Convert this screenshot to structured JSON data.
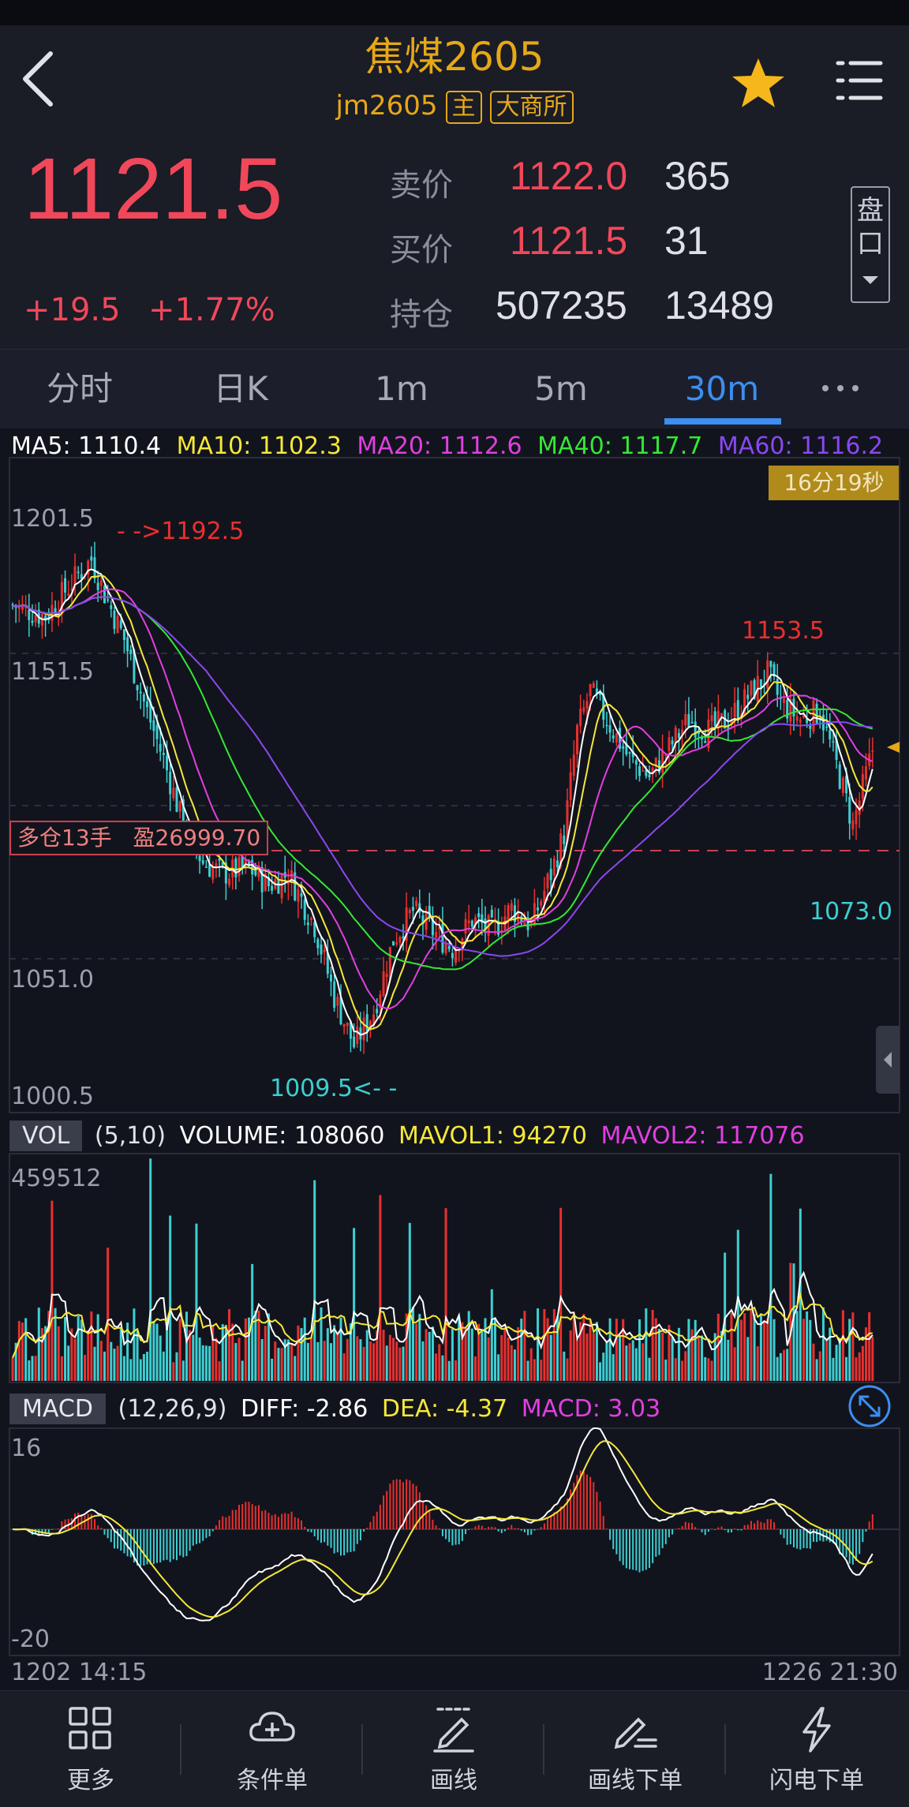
{
  "header": {
    "title": "焦煤2605",
    "code": "jm2605",
    "tag_main": "主",
    "tag_exchange": "大商所"
  },
  "quote": {
    "last_price": "1121.5",
    "change": "+19.5",
    "change_pct": "+1.77%",
    "ask_label": "卖价",
    "ask_price": "1122.0",
    "ask_vol": "365",
    "bid_label": "买价",
    "bid_price": "1121.5",
    "bid_vol": "31",
    "oi_label": "持仓",
    "open_interest": "507235",
    "oi_change": "13489",
    "panel_button": "盘口"
  },
  "tabs": [
    "分时",
    "日K",
    "1m",
    "5m",
    "30m"
  ],
  "active_tab": "30m",
  "main_chart": {
    "ma_labels": [
      {
        "text": "MA5: 1110.4",
        "color": "#ffffff"
      },
      {
        "text": "MA10: 1102.3",
        "color": "#f5e83a"
      },
      {
        "text": "MA20: 1112.6",
        "color": "#e040e0"
      },
      {
        "text": "MA40: 1117.7",
        "color": "#34e834"
      },
      {
        "text": "MA60: 1116.2",
        "color": "#8a48f0"
      }
    ],
    "countdown": "16分19秒",
    "y_ticks": [
      "1201.5",
      "1151.5",
      "1051.0",
      "1000.5"
    ],
    "high_note": "- ->1192.5",
    "low_note": "1009.5<- -",
    "recent_high": "1153.5",
    "recent_low": "1073.0",
    "position_label": "多仓13手",
    "position_pnl": "盈26999.70",
    "bullish_color": "#e8302f",
    "bearish_color": "#3dcfd2"
  },
  "volume": {
    "badge": "VOL",
    "params": "(5,10)",
    "volume_text": "VOLUME: 108060",
    "mavol1_text": "MAVOL1: 94270",
    "mavol2_text": "MAVOL2: 117076",
    "max_label": "459512"
  },
  "macd": {
    "badge": "MACD",
    "params": "(12,26,9)",
    "diff_text": "DIFF: -2.86",
    "dea_text": "DEA: -4.37",
    "macd_text": "MACD: 3.03",
    "top_label": "16",
    "bottom_label": "-20"
  },
  "time_axis": {
    "start": "1202 14:15",
    "end": "1226 21:30"
  },
  "bottom_bar": [
    {
      "label": "更多",
      "icon": "grid-icon"
    },
    {
      "label": "条件单",
      "icon": "cloud-plus-icon"
    },
    {
      "label": "画线",
      "icon": "pen-line-icon"
    },
    {
      "label": "画线下单",
      "icon": "pen-order-icon"
    },
    {
      "label": "闪电下单",
      "icon": "lightning-icon"
    }
  ]
}
